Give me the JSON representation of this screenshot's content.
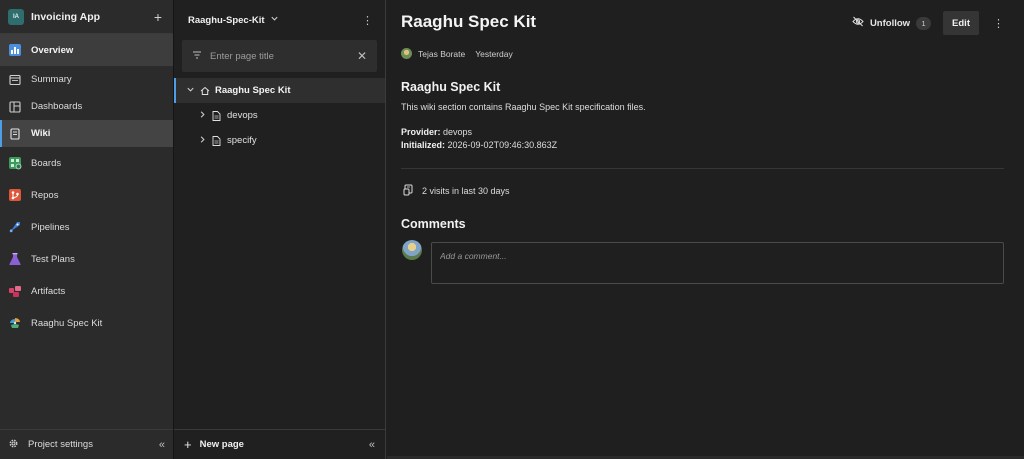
{
  "project": {
    "initials": "IA",
    "name": "Invoicing App"
  },
  "nav": {
    "items": [
      {
        "label": "Overview"
      },
      {
        "label": "Summary"
      },
      {
        "label": "Dashboards"
      },
      {
        "label": "Wiki"
      },
      {
        "label": "Boards"
      },
      {
        "label": "Repos"
      },
      {
        "label": "Pipelines"
      },
      {
        "label": "Test Plans"
      },
      {
        "label": "Artifacts"
      },
      {
        "label": "Raaghu Spec Kit"
      }
    ],
    "footer_label": "Project settings",
    "collapse_glyph": "«"
  },
  "wiki": {
    "name": "Raaghu-Spec-Kit",
    "filter_placeholder": "Enter page title",
    "tree": {
      "root": "Raaghu Spec Kit",
      "children": [
        "devops",
        "specify"
      ]
    },
    "new_page_label": "New page",
    "collapse_glyph": "«"
  },
  "page": {
    "title": "Raaghu Spec Kit",
    "unfollow_label": "Unfollow",
    "follow_count": "1",
    "edit_label": "Edit",
    "author": "Tejas Borate",
    "time": "Yesterday",
    "heading": "Raaghu Spec Kit",
    "description": "This wiki section contains Raaghu Spec Kit specification files.",
    "provider_key": "Provider:",
    "provider_value": "devops",
    "initialized_key": "Initialized:",
    "initialized_value": "2026-09-02T09:46:30.863Z",
    "visits": "2 visits in last 30 days",
    "comments_title": "Comments",
    "comment_placeholder": "Add a comment..."
  },
  "colors": {
    "accent": "#4f9fe8",
    "background": "#1f1f1f",
    "nav_background": "#2b2b2b"
  },
  "icons": {
    "overview": "overview-icon",
    "summary": "summary-icon",
    "dashboards": "dashboards-icon",
    "wiki": "wiki-icon",
    "boards": "boards-icon",
    "repos": "repos-icon",
    "pipelines": "pipelines-icon",
    "test_plans": "test-plans-icon",
    "artifacts": "artifacts-icon",
    "spec_kit": "spec-kit-icon"
  }
}
